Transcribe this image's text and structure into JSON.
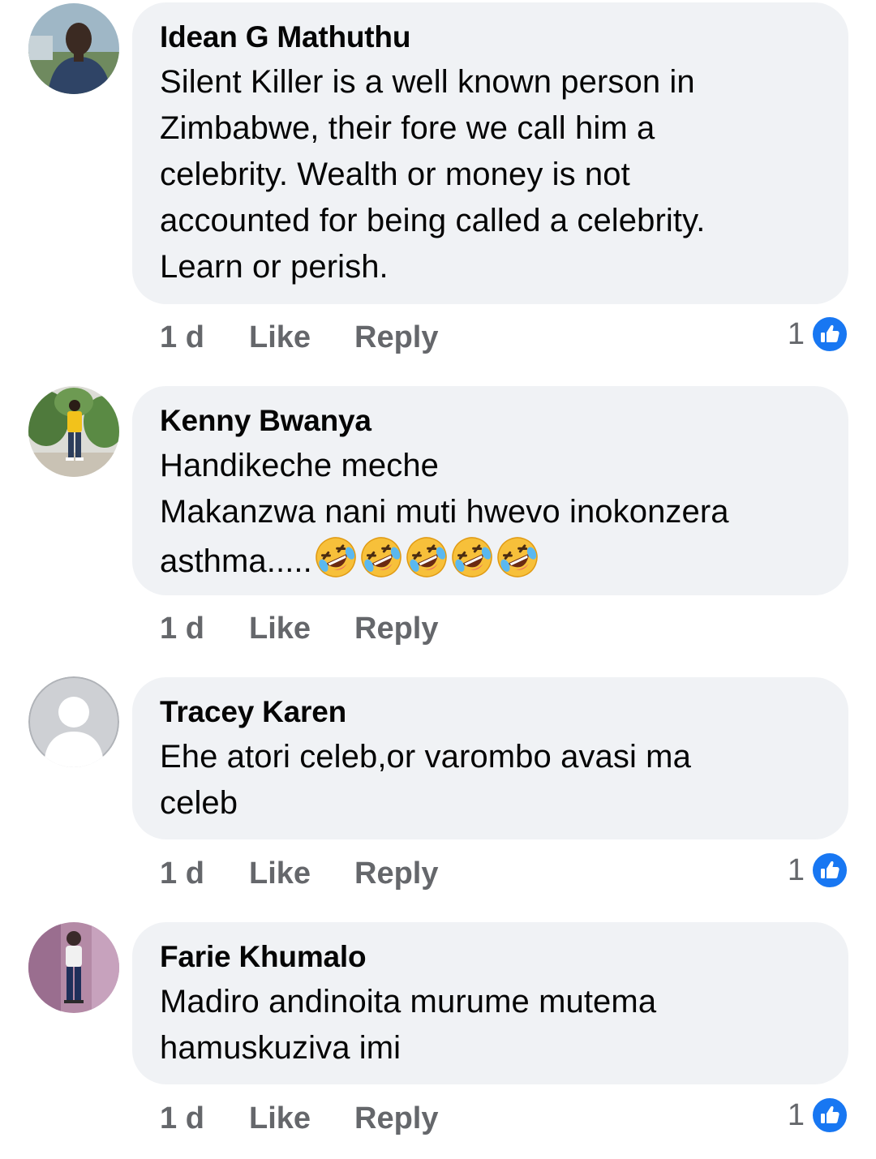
{
  "comments": [
    {
      "author": "Idean G Mathuthu",
      "lines": [
        "Silent Killer is a well known person in",
        "Zimbabwe, their fore we call him a",
        "celebrity. Wealth or money is not",
        "accounted for being called a celebrity.",
        "Learn or perish."
      ],
      "time": "1 d",
      "like_label": "Like",
      "reply_label": "Reply",
      "reaction_count": "1",
      "reaction_icon": "like-reaction-icon"
    },
    {
      "author": "Kenny Bwanya",
      "lines": [
        "Handikeche meche",
        "Makanzwa nani muti hwevo inokonzera",
        "asthma....."
      ],
      "emoji": [
        "rolling-on-floor-laughing",
        "rolling-on-floor-laughing",
        "rolling-on-floor-laughing",
        "rolling-on-floor-laughing",
        "rolling-on-floor-laughing"
      ],
      "time": "1 d",
      "like_label": "Like",
      "reply_label": "Reply"
    },
    {
      "author": "Tracey Karen",
      "lines": [
        "Ehe atori celeb,or varombo avasi ma",
        "celeb"
      ],
      "time": "1 d",
      "like_label": "Like",
      "reply_label": "Reply",
      "reaction_count": "1",
      "reaction_icon": "like-reaction-icon"
    },
    {
      "author": "Farie Khumalo",
      "lines": [
        "Madiro andinoita murume mutema",
        "hamuskuziva imi"
      ],
      "time": "1 d",
      "like_label": "Like",
      "reply_label": "Reply",
      "reaction_count": "1",
      "reaction_icon": "like-reaction-icon"
    }
  ],
  "colors": {
    "bubble": "#f0f2f5",
    "meta_text": "#65676b",
    "like_blue": "#1877f2"
  }
}
